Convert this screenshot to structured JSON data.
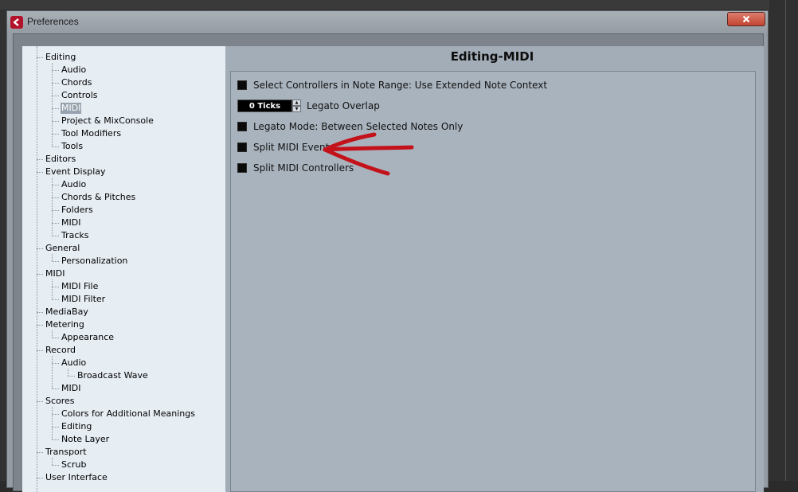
{
  "window": {
    "title": "Preferences",
    "close_glyph": "✕"
  },
  "tree": [
    {
      "label": "Editing",
      "level": 0
    },
    {
      "label": "Audio",
      "level": 1
    },
    {
      "label": "Chords",
      "level": 1
    },
    {
      "label": "Controls",
      "level": 1
    },
    {
      "label": "MIDI",
      "level": 1,
      "selected": true
    },
    {
      "label": "Project & MixConsole",
      "level": 1
    },
    {
      "label": "Tool Modifiers",
      "level": 1
    },
    {
      "label": "Tools",
      "level": 1
    },
    {
      "label": "Editors",
      "level": 0
    },
    {
      "label": "Event Display",
      "level": 0
    },
    {
      "label": "Audio",
      "level": 1
    },
    {
      "label": "Chords & Pitches",
      "level": 1
    },
    {
      "label": "Folders",
      "level": 1
    },
    {
      "label": "MIDI",
      "level": 1
    },
    {
      "label": "Tracks",
      "level": 1
    },
    {
      "label": "General",
      "level": 0
    },
    {
      "label": "Personalization",
      "level": 1
    },
    {
      "label": "MIDI",
      "level": 0
    },
    {
      "label": "MIDI File",
      "level": 1
    },
    {
      "label": "MIDI Filter",
      "level": 1
    },
    {
      "label": "MediaBay",
      "level": 0
    },
    {
      "label": "Metering",
      "level": 0
    },
    {
      "label": "Appearance",
      "level": 1
    },
    {
      "label": "Record",
      "level": 0
    },
    {
      "label": "Audio",
      "level": 1
    },
    {
      "label": "Broadcast Wave",
      "level": 2
    },
    {
      "label": "MIDI",
      "level": 1
    },
    {
      "label": "Scores",
      "level": 0
    },
    {
      "label": "Colors for Additional Meanings",
      "level": 1
    },
    {
      "label": "Editing",
      "level": 1
    },
    {
      "label": "Note Layer",
      "level": 1
    },
    {
      "label": "Transport",
      "level": 0
    },
    {
      "label": "Scrub",
      "level": 1
    },
    {
      "label": "User Interface",
      "level": 0
    }
  ],
  "panel": {
    "title": "Editing-MIDI",
    "options": [
      {
        "name": "select-controllers-note-range-checkbox",
        "type": "checkbox",
        "label": "Select Controllers in Note Range: Use Extended Note Context",
        "checked": true
      },
      {
        "name": "legato-overlap-stepper",
        "type": "stepper",
        "value": "0 Ticks",
        "label": "Legato Overlap"
      },
      {
        "name": "legato-mode-checkbox",
        "type": "checkbox",
        "label": "Legato Mode: Between Selected Notes Only",
        "checked": true
      },
      {
        "name": "split-midi-events-checkbox",
        "type": "checkbox",
        "label": "Split MIDI Events",
        "checked": true
      },
      {
        "name": "split-midi-controllers-checkbox",
        "type": "checkbox",
        "label": "Split MIDI Controllers",
        "checked": true
      }
    ]
  },
  "colors": {
    "annotation_arrow": "#c4121b",
    "app_icon": "#b3122c",
    "selected_item": "#97a3ae"
  },
  "icons": {
    "app": "app-logo-icon",
    "close": "close-icon",
    "annotation": "red-arrow-annotation"
  }
}
